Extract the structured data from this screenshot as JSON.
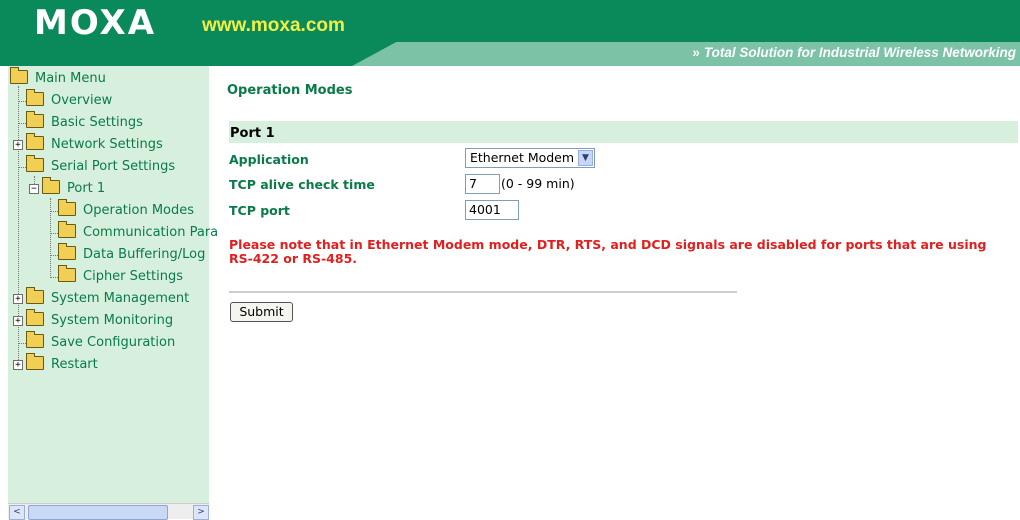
{
  "header": {
    "logo": "MOXA",
    "url": "www.moxa.com",
    "tagline_arrows": "»",
    "tagline": "Total Solution for Industrial Wireless Networking"
  },
  "sidebar": {
    "items": [
      {
        "label": "Main Menu"
      },
      {
        "label": "Overview"
      },
      {
        "label": "Basic Settings"
      },
      {
        "label": "Network Settings"
      },
      {
        "label": "Serial Port Settings"
      },
      {
        "label": "Port 1"
      },
      {
        "label": "Operation Modes"
      },
      {
        "label": "Communication Para"
      },
      {
        "label": "Data Buffering/Log"
      },
      {
        "label": "Cipher Settings"
      },
      {
        "label": "System Management"
      },
      {
        "label": "System Monitoring"
      },
      {
        "label": "Save Configuration"
      },
      {
        "label": "Restart"
      }
    ],
    "expander_plus": "+",
    "expander_minus": "−",
    "scroll_left": "<",
    "scroll_right": ">"
  },
  "main": {
    "page_title": "Operation Modes",
    "section_title": "Port 1",
    "fields": {
      "application": {
        "label": "Application",
        "value": "Ethernet Modem"
      },
      "tcp_alive": {
        "label": "TCP alive check time",
        "value": "7",
        "unit": "(0 - 99 min)"
      },
      "tcp_port": {
        "label": "TCP port",
        "value": "4001"
      }
    },
    "notice": "Please note that in Ethernet Modem mode, DTR, RTS, and DCD signals are disabled for ports that are using RS-422 or RS-485.",
    "submit_label": "Submit"
  },
  "colors": {
    "brand_green": "#0a8a5a",
    "label_green": "#0a7a49",
    "panel_green": "#d7f0dd",
    "warning_red": "#e02020",
    "url_yellow": "#f3ee46"
  }
}
